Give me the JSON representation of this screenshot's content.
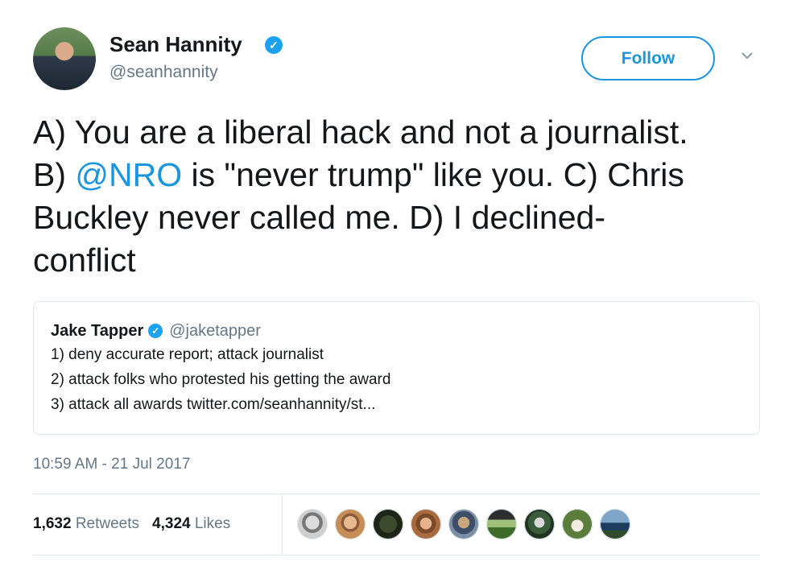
{
  "author": {
    "name": "Sean Hannity",
    "handle": "@seanhannity",
    "verified": true
  },
  "follow_label": "Follow",
  "tweet": {
    "line1": "A) You are a liberal hack and not a journalist.",
    "line2_pre": "B) ",
    "line2_mention": "@NRO",
    "line2_post": " is \"never trump\"  like you. C) Chris",
    "line3": "Buckley never called me. D) I declined-",
    "line4": "conflict"
  },
  "quoted": {
    "name": "Jake Tapper",
    "handle": "@jaketapper",
    "lines": [
      "1) deny accurate report; attack journalist",
      "2) attack folks who protested his getting the award",
      "3) attack all awards twitter.com/seanhannity/st..."
    ]
  },
  "timestamp": "10:59 AM - 21 Jul 2017",
  "stats": {
    "retweets_count": "1,632",
    "retweets_label": "Retweets",
    "likes_count": "4,324",
    "likes_label": "Likes"
  },
  "colors": {
    "accent": "#1b95e0",
    "verified": "#1da1f2",
    "muted": "#657786"
  },
  "icons": {
    "verified": "verified-badge-icon",
    "menu": "chevron-down-icon"
  }
}
